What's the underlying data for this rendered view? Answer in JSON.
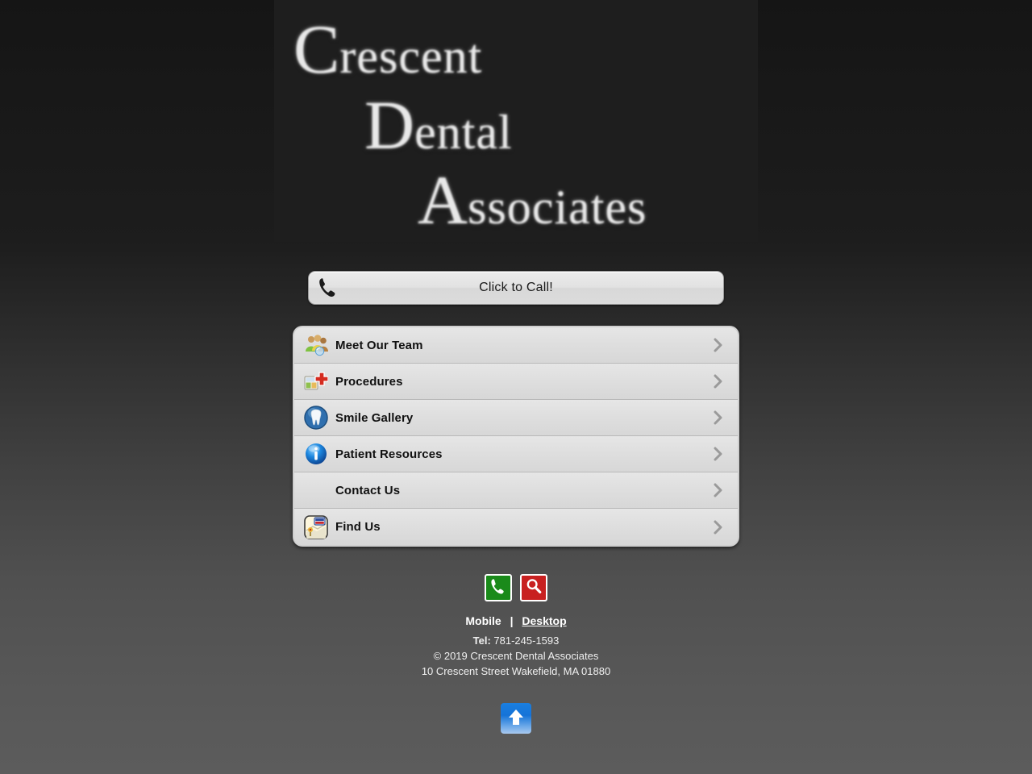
{
  "site": {
    "logo": {
      "line1_cap": "C",
      "line1_rest": "rescent",
      "line2_cap": "D",
      "line2_rest": "ental",
      "line3_cap": "A",
      "line3_rest": "ssociates",
      "alt": "Crescent Dental Associates"
    },
    "accent_dark": "#1e1e1e",
    "panel_gray": "#dedede"
  },
  "call_button": {
    "label": "Click to Call!",
    "icon": "phone-handset-icon"
  },
  "menu": {
    "items": [
      {
        "label": "Meet Our Team",
        "icon": "people-group-icon",
        "has_icon": true
      },
      {
        "label": "Procedures",
        "icon": "medical-cross-icon",
        "has_icon": true
      },
      {
        "label": "Smile Gallery",
        "icon": "tooth-icon",
        "has_icon": true
      },
      {
        "label": "Patient Resources",
        "icon": "info-icon",
        "has_icon": true
      },
      {
        "label": "Contact Us",
        "icon": "",
        "has_icon": false
      },
      {
        "label": "Find Us",
        "icon": "map-pin-icon",
        "has_icon": true
      }
    ],
    "chevron_icon": "chevron-right-icon"
  },
  "footer": {
    "call_icon": "phone-icon",
    "search_icon": "magnifier-icon",
    "call_color": "#1a8a1a",
    "search_color": "#c82020",
    "mobile_label": "Mobile",
    "separator": "|",
    "desktop_label": "Desktop",
    "tel_label": "Tel:",
    "tel_number": "781-245-1593",
    "copyright": "© 2019 Crescent Dental Associates",
    "address": "10 Crescent Street Wakefield, MA 01880",
    "back_to_top_icon": "arrow-up-icon"
  }
}
